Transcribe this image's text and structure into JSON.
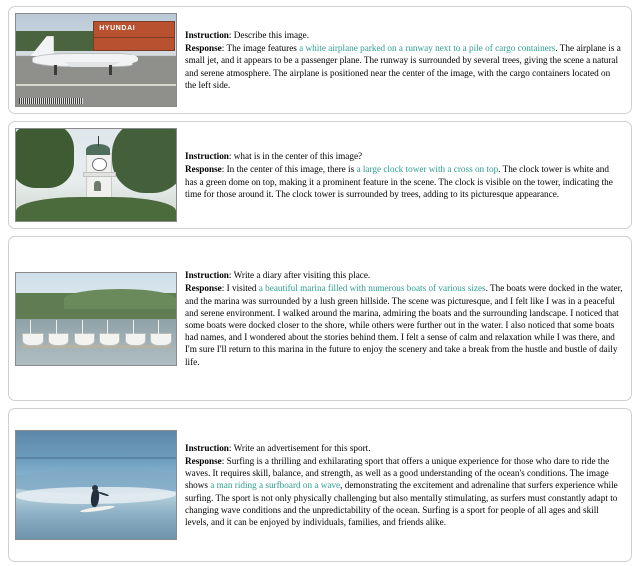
{
  "figure": {
    "examples": [
      {
        "image_name": "airplane-on-runway-with-cargo-containers",
        "instruction_label": "Instruction",
        "instruction": "Describe this image.",
        "response_label": "Response",
        "response_parts": [
          {
            "text": "The image features ",
            "highlight": false
          },
          {
            "text": "a white airplane parked on a runway next to a pile of cargo containers",
            "highlight": true
          },
          {
            "text": ". The airplane is a small jet, and it appears to be a passenger plane. The runway is surrounded by several trees, giving the scene a natural and serene atmosphere. The airplane is positioned near the center of the image, with the cargo containers located on the left side.",
            "highlight": false
          }
        ],
        "image_overlay_text": "HYUNDAI"
      },
      {
        "image_name": "white-clock-tower-with-green-dome",
        "instruction_label": "Instruction",
        "instruction": "what is in the center of this image?",
        "response_label": "Response",
        "response_parts": [
          {
            "text": "In the center of this image, there is ",
            "highlight": false
          },
          {
            "text": "a large clock tower with a cross on top",
            "highlight": true
          },
          {
            "text": ". The clock tower is white and has a green dome on top, making it a prominent feature in the scene. The clock is visible on the tower, indicating the time for those around it. The clock tower is surrounded by trees, adding to its picturesque appearance.",
            "highlight": false
          }
        ]
      },
      {
        "image_name": "marina-with-many-boats-and-green-hillside",
        "instruction_label": "Instruction",
        "instruction": "Write a diary after visiting this place.",
        "response_label": "Response",
        "response_parts": [
          {
            "text": "I visited ",
            "highlight": false
          },
          {
            "text": "a beautiful marina filled with numerous boats of various sizes",
            "highlight": true
          },
          {
            "text": ". The boats were docked in the water, and the marina was surrounded by a lush green hillside. The scene was picturesque, and I felt like I was in a peaceful and serene environment. I walked around the marina, admiring the boats and the surrounding landscape. I noticed that some boats were docked closer to the shore, while others were further out in the water. I also noticed that some boats had names, and I wondered about the stories behind them. I felt a sense of calm and relaxation while I was there, and I'm sure I'll return to this marina in the future to enjoy the scenery and take a break from the hustle and bustle of daily life.",
            "highlight": false
          }
        ]
      },
      {
        "image_name": "man-surfing-on-a-wave",
        "instruction_label": "Instruction",
        "instruction": "Write an advertisement for this sport.",
        "response_label": "Response",
        "response_parts": [
          {
            "text": "Surfing is a thrilling and exhilarating sport that offers a unique experience for those who dare to ride the waves. It requires skill, balance, and strength, as well as a good understanding of the ocean's conditions. The image shows ",
            "highlight": false
          },
          {
            "text": "a man riding a surfboard on a wave",
            "highlight": true
          },
          {
            "text": ", demonstrating the excitement and adrenaline that surfers experience while surfing. The sport is not only physically challenging but also mentally stimulating, as surfers must constantly adapt to changing wave conditions and the unpredictability of the ocean. Surfing is a sport for people of all ages and skill levels, and it can be enjoyed by individuals, families, and friends alike.",
            "highlight": false
          }
        ]
      }
    ],
    "colors": {
      "highlight": "#2f9d8f",
      "card_border": "#cfcfcf",
      "text": "#000000"
    }
  }
}
